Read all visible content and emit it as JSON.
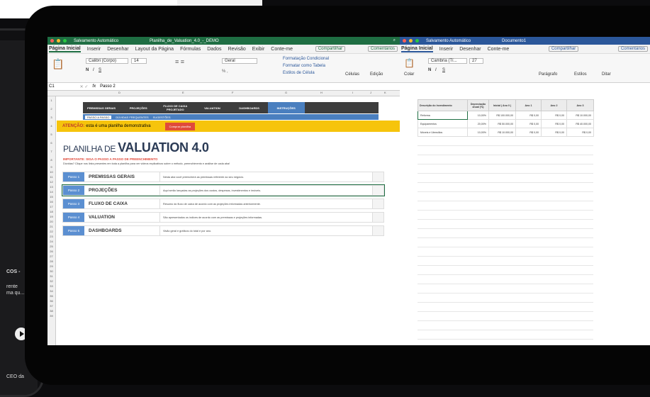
{
  "phone": {
    "text_lines": [
      "COS -",
      "rente",
      "ma qu...",
      "CEO da"
    ]
  },
  "excel": {
    "titlebar": {
      "autosave": "Salvamento Automático",
      "filename": "Planilha_de_Valuation_4.0_-_DEMO"
    },
    "menu": [
      "Página Inicial",
      "Inserir",
      "Desenhar",
      "Layout da Página",
      "Fórmulas",
      "Dados",
      "Revisão",
      "Exibir",
      "Conte-me"
    ],
    "share_label": "Compartilhar",
    "comments_label": "Comentários",
    "ribbon": {
      "font": "Calibri (Corpo)",
      "size": "14",
      "number_format": "Geral",
      "cond_format": "Formatação Condicional",
      "format_table": "Formatar como Tabela",
      "cell_styles": "Estilos de Célula",
      "cells": "Células",
      "editing": "Edição"
    },
    "formula": {
      "cell": "C1",
      "fx": "fx",
      "value": "Passo 2"
    },
    "columns": [
      "A",
      "B",
      "C",
      "D",
      "E",
      "F",
      "G",
      "H",
      "I",
      "J",
      "K"
    ],
    "rows": [
      "1",
      "2",
      "3",
      "4",
      "5",
      "6",
      "7",
      "8",
      "9",
      "10",
      "11",
      "12",
      "13",
      "14",
      "15",
      "16",
      "17",
      "18",
      "19",
      "20",
      "21",
      "22",
      "23",
      "24",
      "25",
      "26",
      "27",
      "28",
      "29",
      "30",
      "31",
      "32",
      "33",
      "34",
      "35",
      "36",
      "37",
      "38",
      "39"
    ],
    "nav": [
      "PREMISSAS GERAIS",
      "PROJEÇÕES",
      "FLUXO DE CAIXA PROJETADO",
      "VALUATION",
      "DASHBOARDS",
      "INSTRUÇÕES"
    ],
    "subnav": [
      "PASSO A PASSO",
      "DÚVIDAS FREQUENTES",
      "SUGESTÕES"
    ],
    "warning_label": "ATENÇÃO:",
    "warning_text": "esta é uma planilha demonstrativa",
    "buy_button": "Comprar planilha",
    "title_prefix": "PLANILHA DE",
    "title_main": "VALUATION 4.0",
    "important": "IMPORTANTE: SIGA O PASSO A PASSO DE PREENCHIMENTO",
    "doubts": "Dúvidas? Clique nos links presentes em toda a planilha para ver vídeos explicativos sobre o método, preenchimento e análise de cada aba!",
    "steps": [
      {
        "badge": "Passo 1",
        "name": "PREMISSAS GERAIS",
        "desc": "Nesta aba você preencherá as premissas referente ao seu negócio."
      },
      {
        "badge": "Passo 2",
        "name": "PROJEÇÕES",
        "desc": "Aqui serão lançadas as projeções dos custos, despesas, investimentos e imóveis."
      },
      {
        "badge": "Passo 3",
        "name": "FLUXO DE CAIXA",
        "desc": "Resumo do fluxo de caixa de acordo com as projeções informadas anteriormente."
      },
      {
        "badge": "Passo 4",
        "name": "VALUATION",
        "desc": "São apresentados os índices de acordo com as premissas e projeções informadas."
      },
      {
        "badge": "Passo 5",
        "name": "DASHBOARDS",
        "desc": "Visão geral e gráficos do total e por ano."
      }
    ]
  },
  "word": {
    "titlebar": {
      "autosave": "Salvamento Automático",
      "filename": "Documento1"
    },
    "menu": [
      "Página Inicial",
      "Inserir",
      "Desenhar",
      "Conte-me"
    ],
    "share_label": "Compartilhar",
    "comments_label": "Comentários",
    "ribbon": {
      "paste": "Colar",
      "font": "Cambria (Tí...",
      "size": "27",
      "paragraph": "Parágrafo",
      "styles": "Estilos",
      "dictate": "Ditar"
    },
    "table": {
      "headers": [
        "Descrição do Investimento",
        "Depreciação anual (%)",
        "Inicial ( Ano 0 )",
        "Ano 1",
        "Ano 2",
        "Ano 3"
      ],
      "rows": [
        [
          "Reforma",
          "10,00%",
          "R$ 100.000,00",
          "R$ 0,00",
          "R$ 0,00",
          "R$ 10.000,00"
        ],
        [
          "Equipamentos",
          "20,00%",
          "R$ 50.000,00",
          "R$ 0,00",
          "R$ 0,00",
          "R$ 40.000,00"
        ],
        [
          "Móveis e Utensílios",
          "10,00%",
          "R$ 10.000,00",
          "R$ 0,00",
          "R$ 0,00",
          "R$ 0,00"
        ]
      ]
    }
  }
}
